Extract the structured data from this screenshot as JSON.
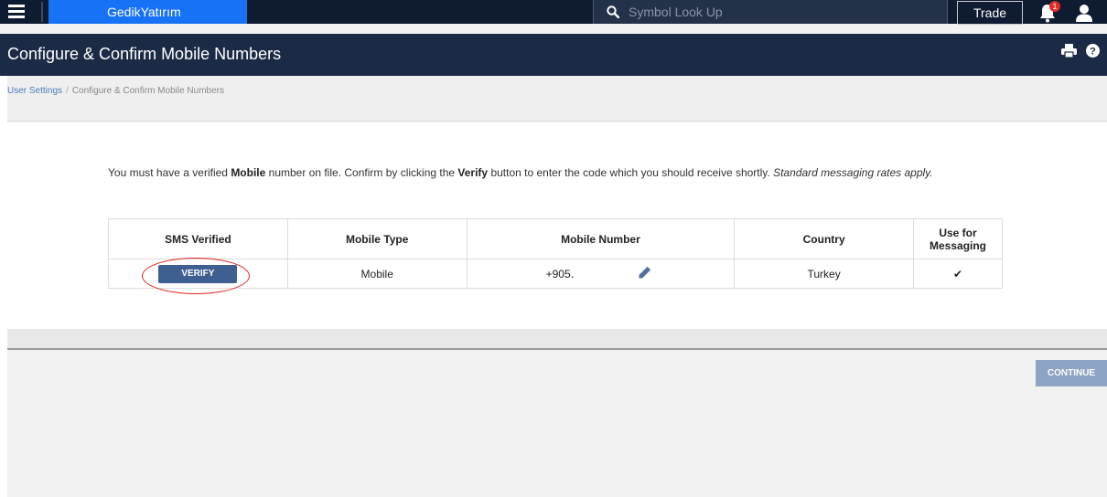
{
  "topnav": {
    "brand": "GedikYatırım",
    "search_placeholder": "Symbol Look Up",
    "trade_label": "Trade",
    "notification_count": "1",
    "icons": [
      "menu-icon",
      "search-icon",
      "bell-icon",
      "user-icon"
    ]
  },
  "titlebar": {
    "title": "Configure & Confirm Mobile Numbers",
    "icons": [
      "print-icon",
      "help-icon"
    ]
  },
  "breadcrumb": {
    "parent": "User Settings",
    "separator": "/",
    "current": "Configure & Confirm Mobile Numbers"
  },
  "intro": {
    "part1": "You must have a verified ",
    "bold1": "Mobile",
    "part2": " number on file. Confirm by clicking the ",
    "bold2": "Verify",
    "part3": " button to enter the code which you should receive shortly. ",
    "italic": "Standard messaging rates apply."
  },
  "table": {
    "headers": [
      "SMS Verified",
      "Mobile Type",
      "Mobile Number",
      "Country",
      "Use for Messaging"
    ],
    "row": {
      "verify_label": "VERIFY",
      "mobile_type": "Mobile",
      "mobile_number": "+905․",
      "country": "Turkey",
      "use_for_messaging": "✔"
    }
  },
  "footer": {
    "continue_label": "CONTINUE"
  },
  "colors": {
    "nav_bg": "#0f1b31",
    "title_bg": "#1b2b45",
    "brand_bg": "#1673f5",
    "verify_bg": "#3e5f8f",
    "continue_bg": "#8da4c4",
    "annotation_red": "#e0241b"
  }
}
